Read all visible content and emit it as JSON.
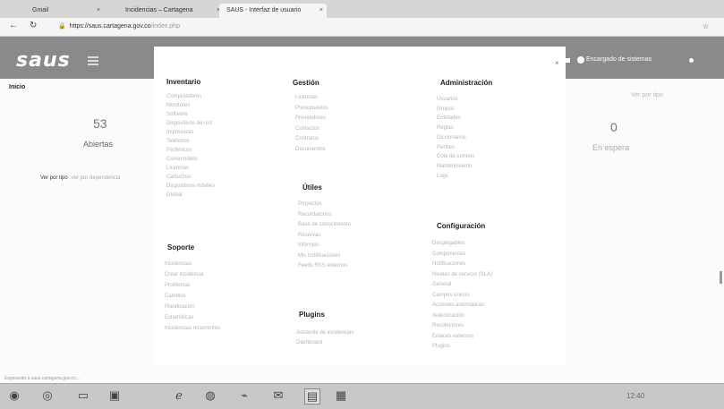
{
  "browser": {
    "tabs": [
      {
        "label": "Gmail"
      },
      {
        "label": "Incidencias – Cartagena"
      },
      {
        "label": "SAUS - Interfaz de usuario"
      }
    ],
    "url": "https://saus.cartagena.gov.co",
    "url_extra": "/index.php"
  },
  "header": {
    "logo": "saus",
    "user": "Encargado de sistemas"
  },
  "page": {
    "breadcrumb": "Inicio",
    "left_count": "53",
    "left_label": "Abiertas",
    "left_link": "Ver por tipo",
    "left_link_extra": "ver por dependencia",
    "right_count": "0",
    "right_label": "En espera",
    "right_link": "Ver por tipo"
  },
  "menu": {
    "sections": {
      "inventario": {
        "title": "Inventario",
        "items": [
          "Computadores",
          "Monitores",
          "Software",
          "Dispositivos de red",
          "Impresoras",
          "Teléfonos",
          "Periféricos",
          "Consumibles",
          "Licencias",
          "Cartuchos",
          "Dispositivos móviles",
          "Global"
        ]
      },
      "gestion": {
        "title": "Gestión",
        "items": [
          "Licencias",
          "Presupuestos",
          "Proveedores",
          "Contactos",
          "Contratos",
          "Documentos"
        ]
      },
      "administracion": {
        "title": "Administración",
        "items": [
          "Usuarios",
          "Grupos",
          "Entidades",
          "Reglas",
          "Diccionarios",
          "Perfiles",
          "Cola de correos",
          "Mantenimiento",
          "Logs"
        ]
      },
      "soporte": {
        "title": "Soporte",
        "items": [
          "Incidencias",
          "Crear incidencia",
          "Problemas",
          "Cambios",
          "Planificación",
          "Estadísticas",
          "Incidencias recurrentes"
        ]
      },
      "utiles": {
        "title": "Útiles",
        "items": [
          "Proyectos",
          "Recordatorios",
          "Base de conocimiento",
          "Reservas",
          "Informes",
          "Mis notificaciones",
          "Feeds RSS externos"
        ]
      },
      "plugins": {
        "title": "Plugins",
        "items": [
          "Asistente de incidencias",
          "Dashboard"
        ]
      },
      "configuracion": {
        "title": "Configuración",
        "items": [
          "Desplegables",
          "Componentes",
          "Notificaciones",
          "Niveles de servicio (SLA)",
          "General",
          "Campos únicos",
          "Acciones automáticas",
          "Autenticación",
          "Recolectores",
          "Enlaces externos",
          "Plugins"
        ]
      }
    }
  },
  "statusbar": {
    "text": "Esperando a saus.cartagena.gov.co..."
  },
  "taskbar": {
    "clock": "12:40"
  }
}
